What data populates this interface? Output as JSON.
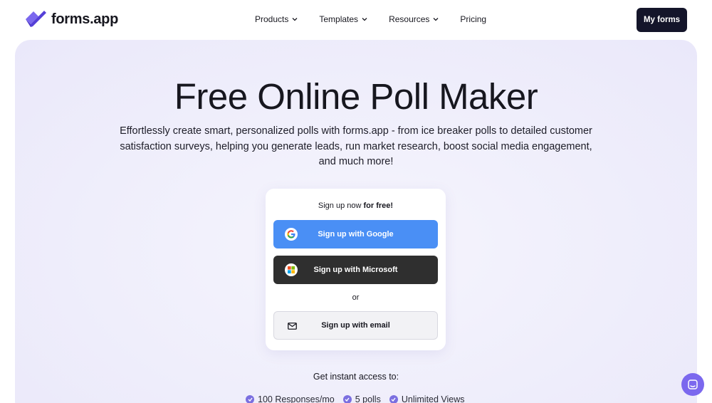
{
  "header": {
    "logo_text": "forms.app",
    "nav": [
      {
        "label": "Products",
        "dropdown": true
      },
      {
        "label": "Templates",
        "dropdown": true
      },
      {
        "label": "Resources",
        "dropdown": true
      },
      {
        "label": "Pricing",
        "dropdown": false
      }
    ],
    "my_forms_label": "My forms"
  },
  "hero": {
    "title": "Free Online Poll Maker",
    "subtitle": "Effortlessly create smart, personalized polls with forms.app - from ice breaker polls to detailed customer satisfaction surveys, helping you generate leads, run market research, boost social media engagement, and much more!"
  },
  "signup": {
    "heading_prefix": "Sign up now ",
    "heading_bold": "for free!",
    "google_label": "Sign up with Google",
    "microsoft_label": "Sign up with Microsoft",
    "or_label": "or",
    "email_label": "Sign up with email"
  },
  "access": {
    "heading": "Get instant access to:",
    "features": [
      "100 Responses/mo",
      "5 polls",
      "Unlimited Views"
    ]
  },
  "colors": {
    "brand_purple": "#7b68ee",
    "google_blue": "#4a8ff5",
    "dark_button": "#14152a",
    "hero_bg": "#efeefb"
  },
  "icons": {
    "logo": "forms-app-logo-icon",
    "nav_dropdown": "chevron-down-icon",
    "google": "google-icon",
    "microsoft": "microsoft-icon",
    "email": "mail-icon",
    "feature_check": "check-circle-icon",
    "chat": "chat-icon"
  }
}
